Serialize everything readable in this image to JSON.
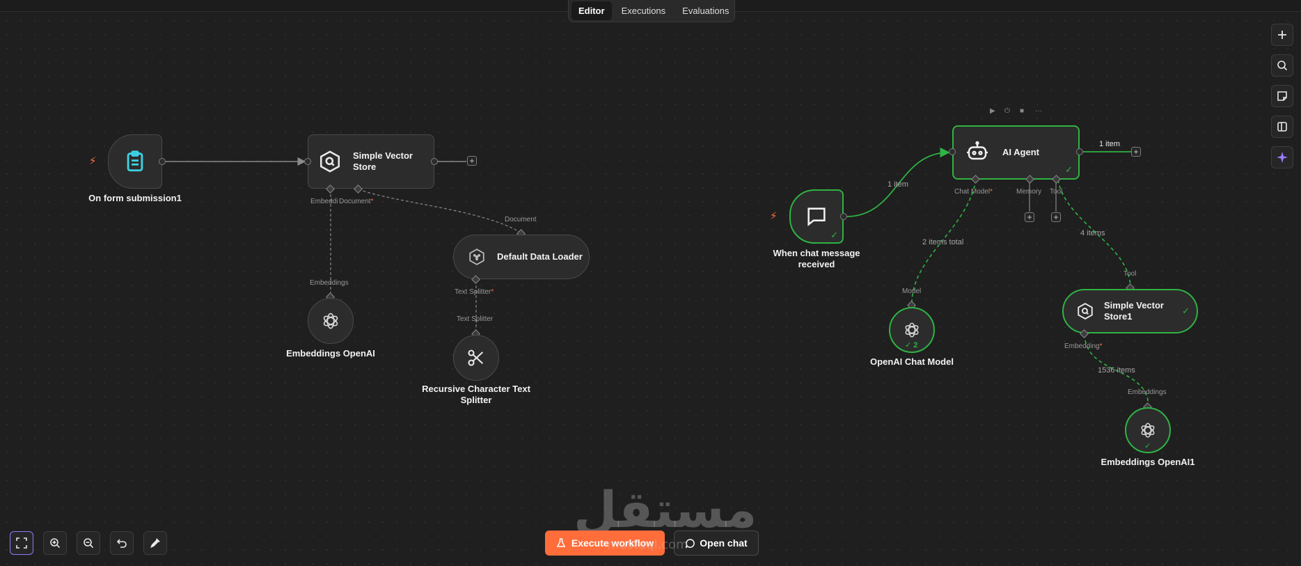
{
  "tabs": [
    "Editor",
    "Executions",
    "Evaluations"
  ],
  "nodes": {
    "form_trigger": {
      "label": "On form submission1"
    },
    "vector_store": {
      "label": "Simple Vector Store",
      "ports": {
        "embedding": "Embeddi",
        "document": "Document"
      }
    },
    "data_loader": {
      "label": "Default Data Loader",
      "ports": {
        "document": "Document",
        "text_splitter": "Text Splitter"
      }
    },
    "embeddings": {
      "label": "Embeddings OpenAI",
      "ports": {
        "embeddings": "Embeddings"
      }
    },
    "splitter": {
      "label": "Recursive Character Text Splitter",
      "ports": {
        "text_splitter": "Text Splitter"
      }
    },
    "chat_trigger": {
      "label": "When chat message received"
    },
    "ai_agent": {
      "label": "AI Agent",
      "ports": {
        "chat_model": "Chat Model",
        "memory": "Memory",
        "tool": "Tool"
      }
    },
    "chat_model": {
      "label": "OpenAI Chat Model",
      "ports": {
        "model": "Model"
      },
      "count": "2"
    },
    "vector_store1": {
      "label": "Simple Vector Store1",
      "ports": {
        "tool": "Tool",
        "embedding": "Embedding"
      }
    },
    "embeddings1": {
      "label": "Embeddings OpenAI1",
      "ports": {
        "embeddings": "Embeddings"
      }
    }
  },
  "edge_labels": {
    "chat_to_agent": "1 item",
    "agent_out": "1 item",
    "model_to_agent": "2 items total",
    "tool_to_agent": "4 items",
    "embed_to_store": "1536 items"
  },
  "bottom": {
    "execute": "Execute workflow",
    "open_chat": "Open chat"
  },
  "watermark": {
    "arabic": "مستقل",
    "latin": "mostaql.com"
  },
  "colors": {
    "accent": "#ff6d3b",
    "success": "#2fb344",
    "canvas": "#1f1f1f"
  }
}
